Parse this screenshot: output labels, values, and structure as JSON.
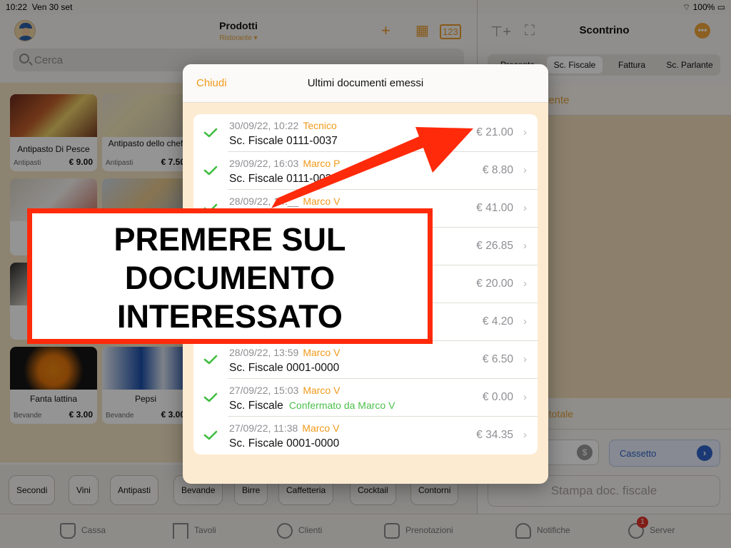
{
  "status_bar": {
    "time": "10:22",
    "date": "Ven 30 set",
    "battery": "100%"
  },
  "products_header": {
    "title": "Prodotti",
    "subtitle": "Ristorante ▾"
  },
  "search": {
    "placeholder": "Cerca"
  },
  "products": [
    {
      "name": "Antipasto Di Pesce",
      "category": "Antipasti",
      "price": "€ 9.00"
    },
    {
      "name": "Antipasto dello chef",
      "category": "Antipasti",
      "price": "€ 7.50"
    },
    {
      "name": "Fanta lattina",
      "category": "Bevande",
      "price": "€ 3.00"
    },
    {
      "name": "Pepsi",
      "category": "Bevande",
      "price": "€ 3.00"
    }
  ],
  "categories": [
    "Secondi",
    "Vini",
    "Antipasti",
    "Bevande",
    "Birre",
    "Caffetteria",
    "Cocktail",
    "Contorni"
  ],
  "receipt_panel": {
    "title": "Scontrino",
    "segments": [
      "Preconto",
      "Sc. Fiscale",
      "Fattura",
      "Sc. Parlante"
    ],
    "active_segment": "Sc. Fiscale",
    "client_label": "iente",
    "subtotal_label": "btotale",
    "drawer_label": "Cassetto",
    "print_label": "Stampa doc. fiscale"
  },
  "tabs": [
    {
      "label": "Cassa",
      "icon": "basket-icon"
    },
    {
      "label": "Tavoli",
      "icon": "table-icon"
    },
    {
      "label": "Clienti",
      "icon": "person-icon"
    },
    {
      "label": "Prenotazioni",
      "icon": "calendar-icon"
    },
    {
      "label": "Notifiche",
      "icon": "bell-icon"
    },
    {
      "label": "Server",
      "icon": "globe-icon"
    }
  ],
  "server_badge": "1",
  "modal": {
    "close_label": "Chiudi",
    "title": "Ultimi documenti emessi",
    "documents": [
      {
        "datetime": "30/09/22, 10:22",
        "user": "Tecnico",
        "doc": "Sc. Fiscale 0111-0037",
        "status": "",
        "amount": "€ 21.00"
      },
      {
        "datetime": "29/09/22, 16:03",
        "user": "Marco P",
        "doc": "Sc. Fiscale 0111-0036",
        "status": "",
        "amount": "€ 8.80"
      },
      {
        "datetime": "28/09/22, 14:__",
        "user": "Marco V",
        "doc": "",
        "status": "",
        "amount": "€ 41.00"
      },
      {
        "datetime": "",
        "user": "",
        "doc": "",
        "status": "",
        "amount": "€ 26.85"
      },
      {
        "datetime": "",
        "user": "",
        "doc": "",
        "status": "",
        "amount": "€ 20.00"
      },
      {
        "datetime": "",
        "user": "",
        "doc": "",
        "status": "",
        "amount": "€ 4.20"
      },
      {
        "datetime": "28/09/22, 13:59",
        "user": "Marco V",
        "doc": "Sc. Fiscale 0001-0000",
        "status": "",
        "amount": "€ 6.50"
      },
      {
        "datetime": "27/09/22, 15:03",
        "user": "Marco V",
        "doc": "Sc. Fiscale",
        "status": "Confermato da Marco V",
        "amount": "€ 0.00"
      },
      {
        "datetime": "27/09/22, 11:38",
        "user": "Marco V",
        "doc": "Sc. Fiscale 0001-0000",
        "status": "",
        "amount": "€ 34.35"
      }
    ]
  },
  "annotation": {
    "lines": [
      "PREMERE SUL",
      "DOCUMENTO",
      "INTERESSATO"
    ],
    "color": "#ff2a0a"
  }
}
